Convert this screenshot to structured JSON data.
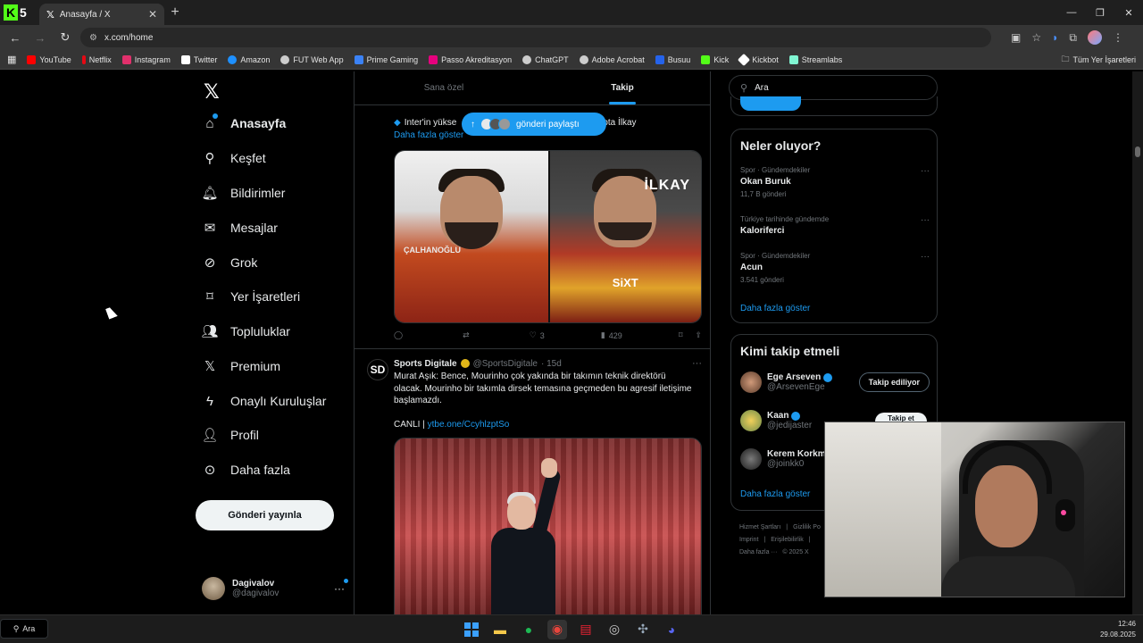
{
  "browser": {
    "tab_title": "Anasayfa / X",
    "tab_icon": "x-logo",
    "url": "x.com/home",
    "new_tab_label": "+",
    "bookmarks": [
      {
        "label": "YouTube",
        "color": "#ff0000"
      },
      {
        "label": "Netflix",
        "color": "#e50914"
      },
      {
        "label": "Instagram",
        "color": "#e1306c"
      },
      {
        "label": "Twitter",
        "color": "#ffffff"
      },
      {
        "label": "Amazon",
        "color": "#1e90ff"
      },
      {
        "label": "FUT Web App",
        "color": "#cccccc"
      },
      {
        "label": "Prime Gaming",
        "color": "#3b82f6"
      },
      {
        "label": "Passo Akreditasyon",
        "color": "#e6007e"
      },
      {
        "label": "ChatGPT",
        "color": "#cccccc"
      },
      {
        "label": "Adobe Acrobat",
        "color": "#cccccc"
      },
      {
        "label": "Busuu",
        "color": "#2563eb"
      },
      {
        "label": "Kick",
        "color": "#53fc18"
      },
      {
        "label": "Kickbot",
        "color": "#ffffff"
      },
      {
        "label": "Streamlabs",
        "color": "#80f5d2"
      }
    ],
    "all_bookmarks_label": "Tüm Yer İşaretleri"
  },
  "nav": {
    "items": [
      {
        "label": "Anasayfa",
        "icon": "home-icon",
        "active": true
      },
      {
        "label": "Keşfet",
        "icon": "search-icon"
      },
      {
        "label": "Bildirimler",
        "icon": "bell-icon"
      },
      {
        "label": "Mesajlar",
        "icon": "mail-icon"
      },
      {
        "label": "Grok",
        "icon": "grok-icon"
      },
      {
        "label": "Yer İşaretleri",
        "icon": "bookmark-icon"
      },
      {
        "label": "Topluluklar",
        "icon": "communities-icon"
      },
      {
        "label": "Premium",
        "icon": "x-icon"
      },
      {
        "label": "Onaylı Kuruluşlar",
        "icon": "lightning-icon"
      },
      {
        "label": "Profil",
        "icon": "person-icon"
      },
      {
        "label": "Daha fazla",
        "icon": "more-circle-icon"
      }
    ],
    "post_button": "Gönderi yayınla",
    "user": {
      "name": "Dagivalov",
      "handle": "@dagivalov"
    }
  },
  "feed": {
    "tabs": [
      "Sana özel",
      "Takip"
    ],
    "active_tab": 1,
    "new_posts_pill": "gönderi paylaştı",
    "tweet1": {
      "text_start": "Inter'in yükse",
      "text_end": "ota İlkay",
      "show_more": "Daha fazla göster",
      "left_player_label": "ÇALHANOĞLU",
      "right_player_label": "İLKAY",
      "sponsor": "SiXT",
      "replies": "",
      "retweets": "",
      "likes": "3",
      "views": "429"
    },
    "tweet2": {
      "avatar_text": "SD",
      "name": "Sports Digitale",
      "handle": "@SportsDigitale",
      "time": "· 15d",
      "more": "···",
      "lines": [
        "Murat Aşık: Bence, Mourinho çok yakında bir takımın teknik direktörü",
        "olacak. Mourinho bir takımla dirsek temasına geçmeden bu agresif iletişime",
        "başlamazdı."
      ],
      "live_label": "CANLI | ",
      "link": "ytbe.one/CcyhlzptSo"
    }
  },
  "right": {
    "search_placeholder": "Ara",
    "trends_title": "Neler oluyor?",
    "trends": [
      {
        "context": "Spor · Gündemdekiler",
        "topic": "Okan Buruk",
        "count": "11,7 B gönderi"
      },
      {
        "context": "Türkiye tarihinde gündemde",
        "topic": "Kaloriferci",
        "count": ""
      },
      {
        "context": "Spor · Gündemdekiler",
        "topic": "Acun",
        "count": "3.541 gönderi"
      }
    ],
    "trends_more": "Daha fazla göster",
    "who_title": "Kimi takip etmeli",
    "who": [
      {
        "name": "Ege Arseven",
        "handle": "@ArsevenEge",
        "button": "Takip ediliyor",
        "verified": true
      },
      {
        "name": "Kaan",
        "handle": "@jedijaster",
        "button": "Takip et",
        "verified": true
      },
      {
        "name": "Kerem Korkm",
        "handle": "@joinkk0",
        "button": "",
        "verified": false
      }
    ],
    "who_more": "Daha fazla göster",
    "footer": [
      "Hizmet Şartları",
      "|",
      "Gizlilik Po",
      "Imprint",
      "|",
      "Erişilebilirlik",
      "|",
      "Daha fazla ···",
      "© 2025 X"
    ]
  },
  "taskbar": {
    "search_label": "Ara",
    "time": "12:46",
    "date": "29.08.2025"
  },
  "colors": {
    "accent": "#1d9bf0",
    "bg": "#000000",
    "muted": "#71767b",
    "border": "#2f3336"
  }
}
